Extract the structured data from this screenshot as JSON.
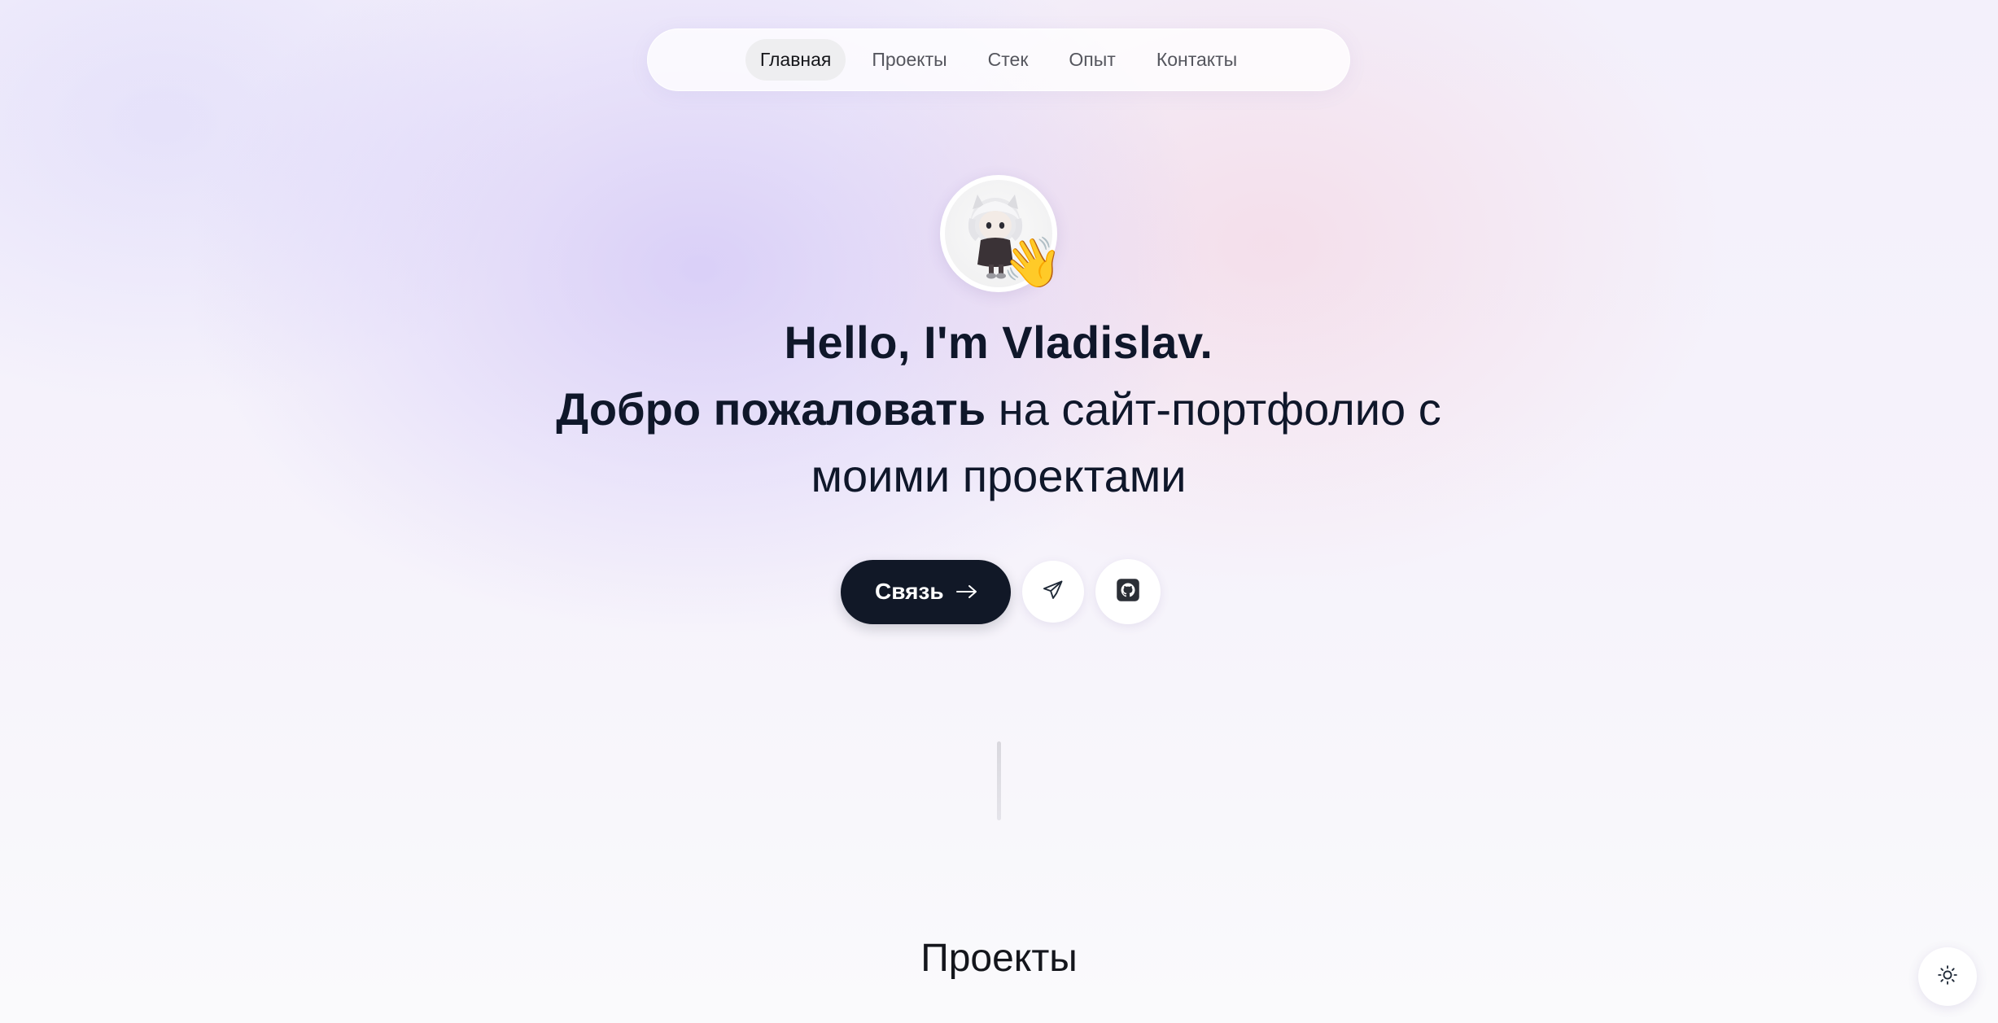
{
  "nav": {
    "items": [
      {
        "label": "Главная",
        "active": true
      },
      {
        "label": "Проекты",
        "active": false
      },
      {
        "label": "Стек",
        "active": false
      },
      {
        "label": "Опыт",
        "active": false
      },
      {
        "label": "Контакты",
        "active": false
      }
    ]
  },
  "avatar": {
    "emoji": "👋",
    "icon": "waving-hand"
  },
  "hero": {
    "greeting": "Hello, I'm Vladislav.",
    "welcome_bold": "Добро пожаловать",
    "welcome_rest_1": " на сайт-портфолио с",
    "welcome_rest_2": "моими проектами"
  },
  "actions": {
    "contact_label": "Связь",
    "contact_icon": "arrow-right-icon",
    "telegram_icon": "telegram-icon",
    "github_icon": "github-icon"
  },
  "sections": {
    "projects_title": "Проекты"
  },
  "theme_toggle": {
    "icon": "sun-icon"
  },
  "colors": {
    "primary_dark": "#111827",
    "text": "#0f172a",
    "nav_text": "#55565e",
    "nav_active_bg": "#eeeef0"
  }
}
